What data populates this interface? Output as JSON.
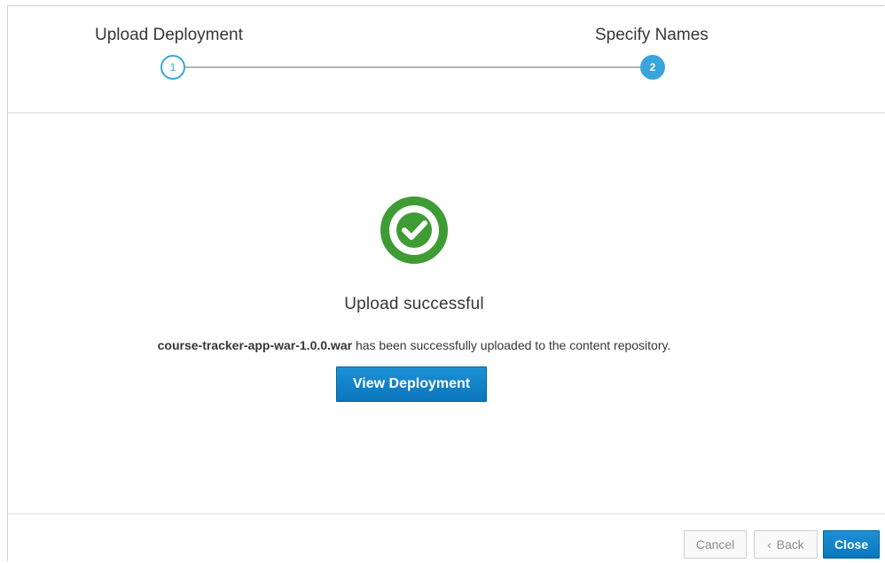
{
  "wizard": {
    "steps": [
      {
        "number": "1",
        "label": "Upload Deployment",
        "state": "completed"
      },
      {
        "number": "2",
        "label": "Specify Names",
        "state": "active"
      }
    ]
  },
  "result": {
    "icon": "check-circle-icon",
    "status_color": "#3f9c35",
    "title": "Upload successful",
    "filename": "course-tracker-app-war-1.0.0.war",
    "message": " has been successfully uploaded to the content repository.",
    "view_button_label": "View Deployment"
  },
  "footer": {
    "cancel_label": "Cancel",
    "back_chevron": "‹",
    "back_label": "Back",
    "close_label": "Close"
  },
  "colors": {
    "accent": "#39a5dc",
    "primary_button": "#0088ce",
    "success": "#3f9c35"
  }
}
